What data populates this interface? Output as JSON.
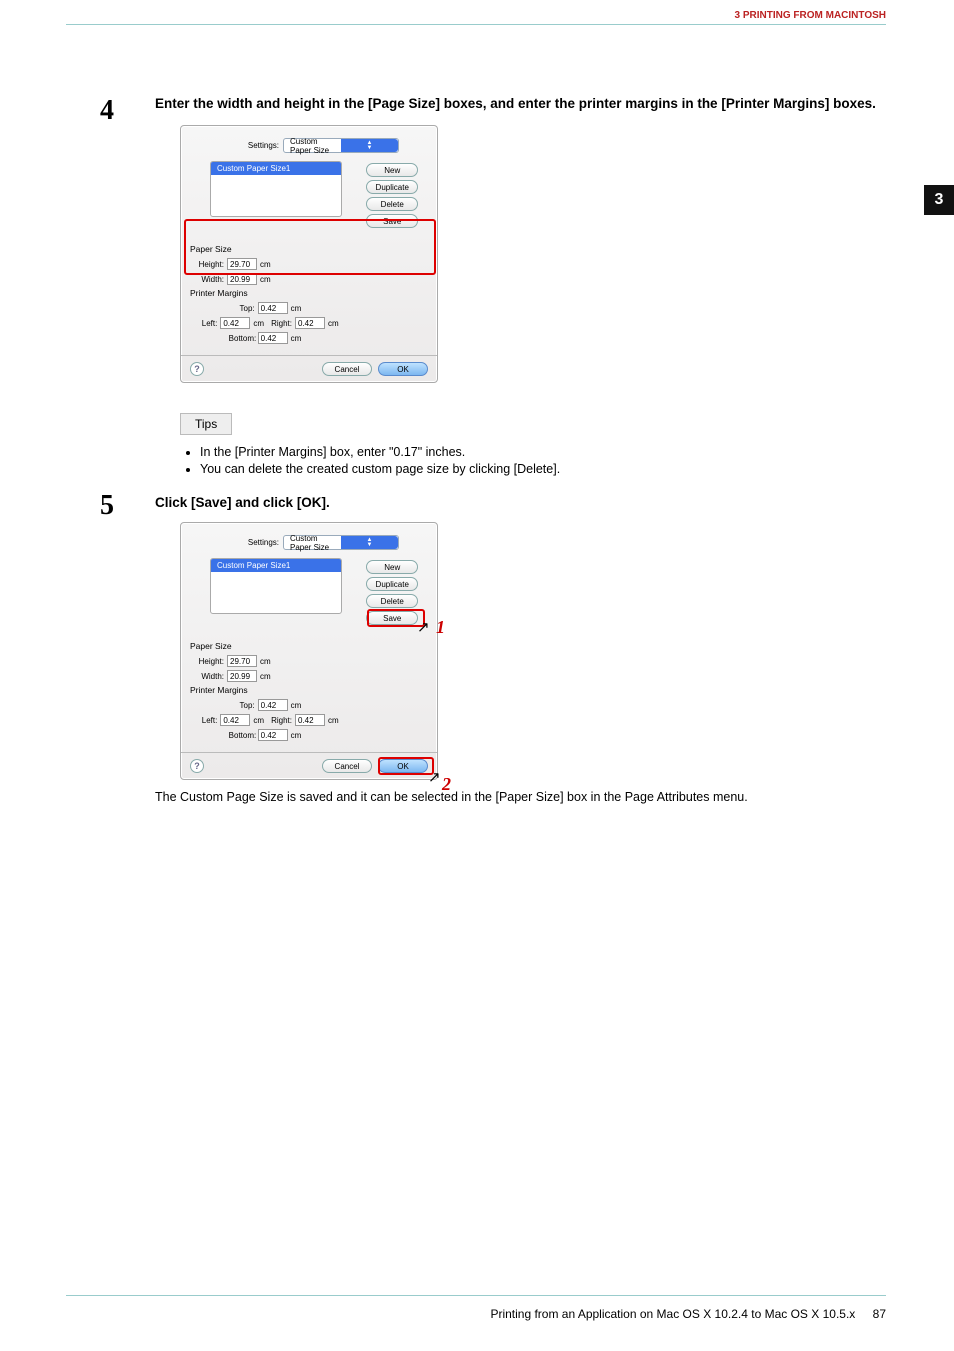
{
  "header": {
    "section": "3 PRINTING FROM MACINTOSH"
  },
  "side_tab": "3",
  "steps": {
    "s4": {
      "num": "4",
      "text": "Enter the width and height in the [Page Size] boxes, and enter the printer margins in the [Printer Margins] boxes."
    },
    "s5": {
      "num": "5",
      "text": "Click [Save] and click [OK]."
    }
  },
  "dlg": {
    "settings_label": "Settings:",
    "settings_value": "Custom Paper Size",
    "list_item": "Custom Paper Size1",
    "btns": {
      "new": "New",
      "dup": "Duplicate",
      "del": "Delete",
      "save": "Save"
    },
    "paper_size_title": "Paper Size",
    "margins_title": "Printer Margins",
    "height_lbl": "Height:",
    "width_lbl": "Width:",
    "height_val": "29.70",
    "width_val": "20.99",
    "unit": "cm",
    "top_lbl": "Top:",
    "left_lbl": "Left:",
    "right_lbl": "Right:",
    "bottom_lbl": "Bottom:",
    "margin_val": "0.42",
    "cancel": "Cancel",
    "ok": "OK"
  },
  "tips_label": "Tips",
  "tips": [
    "In the [Printer Margins] box, enter \"0.17\" inches.",
    "You can delete the created custom page size by clicking [Delete]."
  ],
  "callouts": {
    "one": "1",
    "two": "2"
  },
  "after_step5": "The Custom Page Size is saved and it can be selected in the [Paper Size] box in the Page Attributes menu.",
  "footer": {
    "text": "Printing from an Application on Mac OS X 10.2.4 to Mac OS X 10.5.x",
    "page": "87"
  }
}
